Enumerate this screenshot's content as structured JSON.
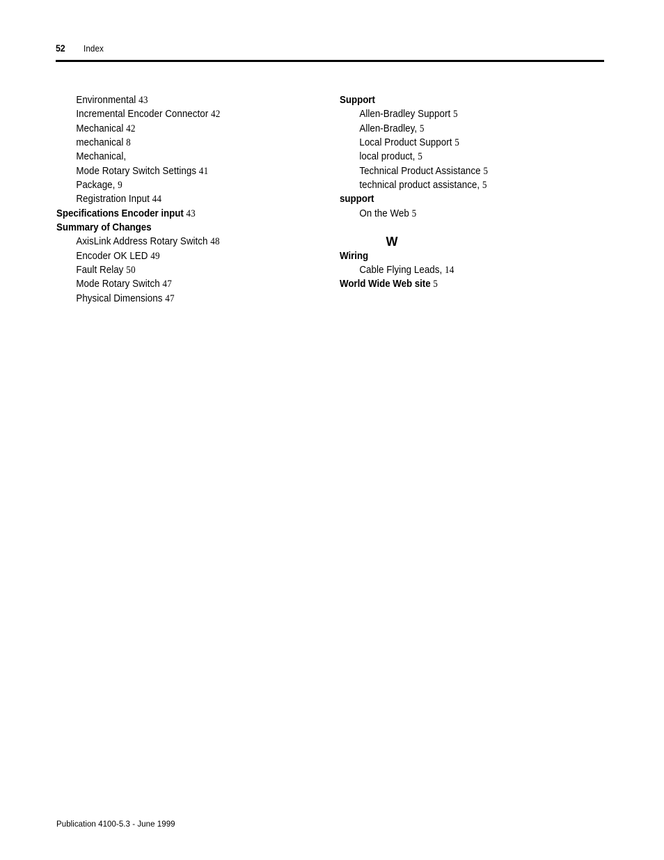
{
  "header": {
    "page_number": "52",
    "title": "Index"
  },
  "left_column": [
    {
      "label": "Environmental",
      "page": "43",
      "style": "sub"
    },
    {
      "label": "Incremental Encoder Connector",
      "page": "42",
      "style": "sub"
    },
    {
      "label": "Mechanical",
      "page": "42",
      "style": "sub"
    },
    {
      "label": "mechanical",
      "page": "8",
      "style": "sub"
    },
    {
      "label": "Mechanical,",
      "page": "",
      "style": "sub"
    },
    {
      "label": "Mode Rotary Switch Settings",
      "page": "41",
      "style": "sub"
    },
    {
      "label": "Package,",
      "page": "9",
      "style": "sub"
    },
    {
      "label": "Registration Input",
      "page": "44",
      "style": "sub"
    },
    {
      "label": "Specifications Encoder input",
      "page": "43",
      "style": "heading"
    },
    {
      "label": "Summary of Changes",
      "page": "",
      "style": "heading"
    },
    {
      "label": "AxisLink Address Rotary Switch",
      "page": "48",
      "style": "sub"
    },
    {
      "label": "Encoder OK LED",
      "page": "49",
      "style": "sub"
    },
    {
      "label": "Fault Relay",
      "page": "50",
      "style": "sub"
    },
    {
      "label": "Mode Rotary Switch",
      "page": "47",
      "style": "sub"
    },
    {
      "label": "Physical Dimensions",
      "page": "47",
      "style": "sub"
    }
  ],
  "right_column": [
    {
      "label": "Support",
      "page": "",
      "style": "heading"
    },
    {
      "label": "Allen-Bradley Support",
      "page": "5",
      "style": "sub"
    },
    {
      "label": "Allen-Bradley,",
      "page": "5",
      "style": "sub"
    },
    {
      "label": "Local Product Support",
      "page": "5",
      "style": "sub"
    },
    {
      "label": "local product,",
      "page": "5",
      "style": "sub"
    },
    {
      "label": "Technical Product Assistance",
      "page": "5",
      "style": "sub"
    },
    {
      "label": "technical product assistance,",
      "page": "5",
      "style": "sub"
    },
    {
      "label": "support",
      "page": "",
      "style": "heading"
    },
    {
      "label": "On the Web",
      "page": "5",
      "style": "sub"
    }
  ],
  "section_letter": "W",
  "right_column_after_letter": [
    {
      "label": "Wiring",
      "page": "",
      "style": "heading"
    },
    {
      "label": "Cable Flying Leads,",
      "page": "14",
      "style": "sub"
    },
    {
      "label": "World Wide Web site",
      "page": "5",
      "style": "heading"
    }
  ],
  "footer": {
    "publication": "Publication 4100-5.3 - June 1999"
  }
}
